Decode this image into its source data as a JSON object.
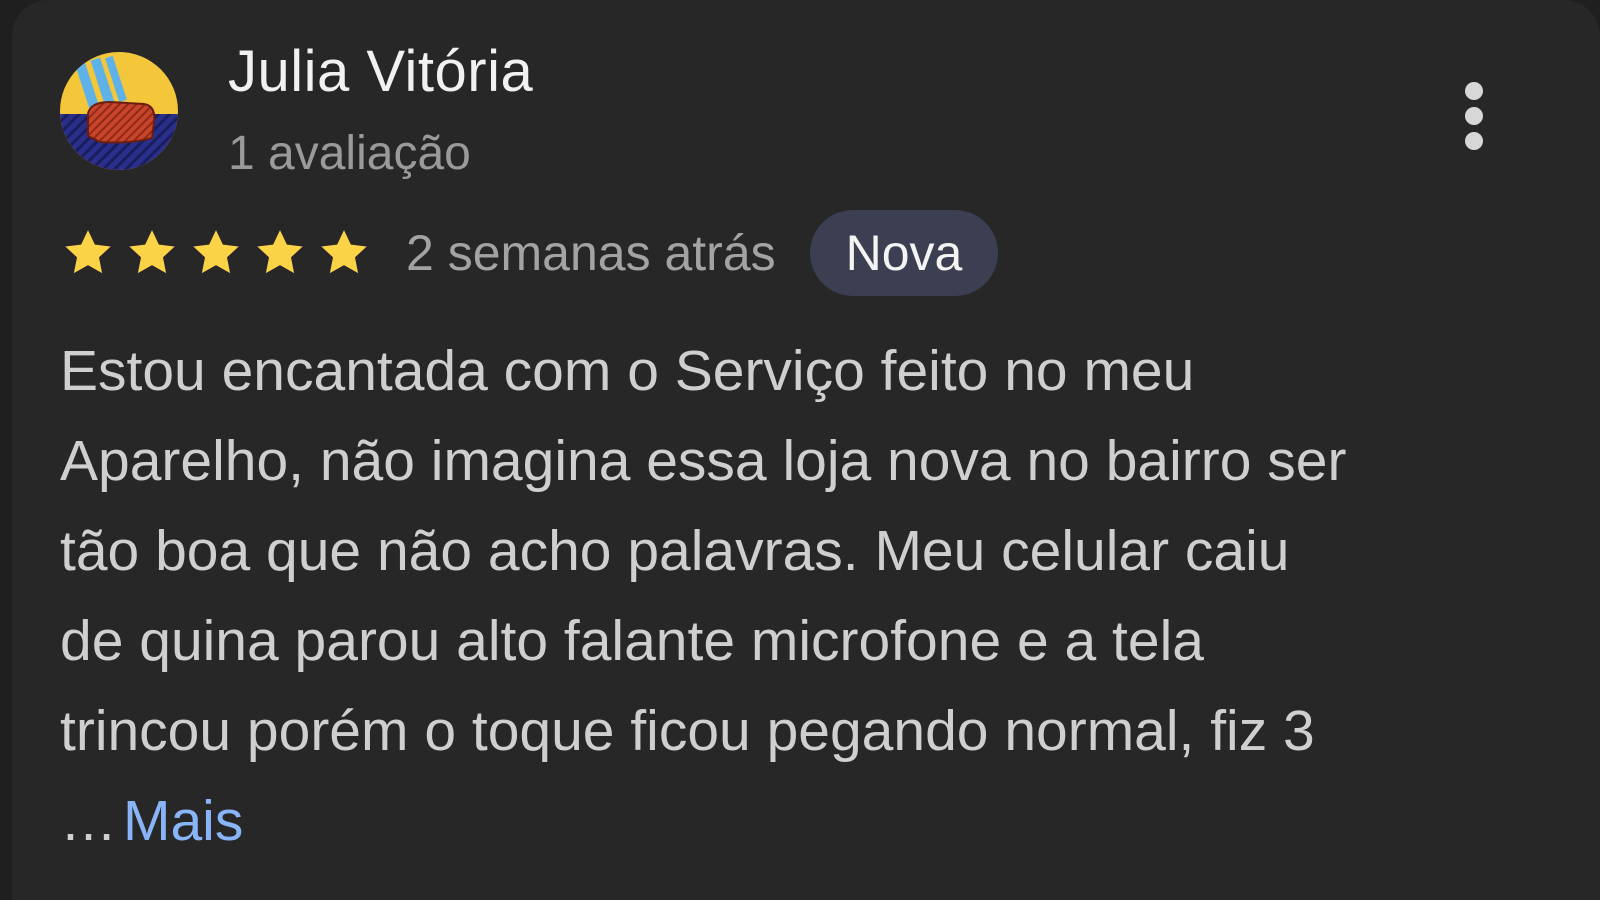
{
  "review": {
    "author_name": "Julia Vitória",
    "author_meta": "1 avaliação",
    "rating": 5,
    "rating_max": 5,
    "date": "2 semanas atrás",
    "badge": "Nova",
    "text_lines": [
      "Estou encantada com o Serviço feito no meu",
      "Aparelho, não imagina essa loja nova no bairro ser",
      "tão boa que não acho palavras. Meu celular caiu",
      "de quina parou alto falante microfone e a tela",
      "trincou porém o toque ficou pegando normal, fiz 3"
    ],
    "ellipsis": "…",
    "more_label": "Mais"
  },
  "icons": {
    "more_menu": "more-vert-icon",
    "star": "star-filled-icon",
    "avatar": "user-avatar-image"
  },
  "colors": {
    "card_background": "#272727",
    "star": "#fbd347",
    "badge_background": "#3b3f51",
    "link": "#8ab4f8",
    "text_primary": "#f1f1f1",
    "text_secondary": "#9a9a9a"
  }
}
